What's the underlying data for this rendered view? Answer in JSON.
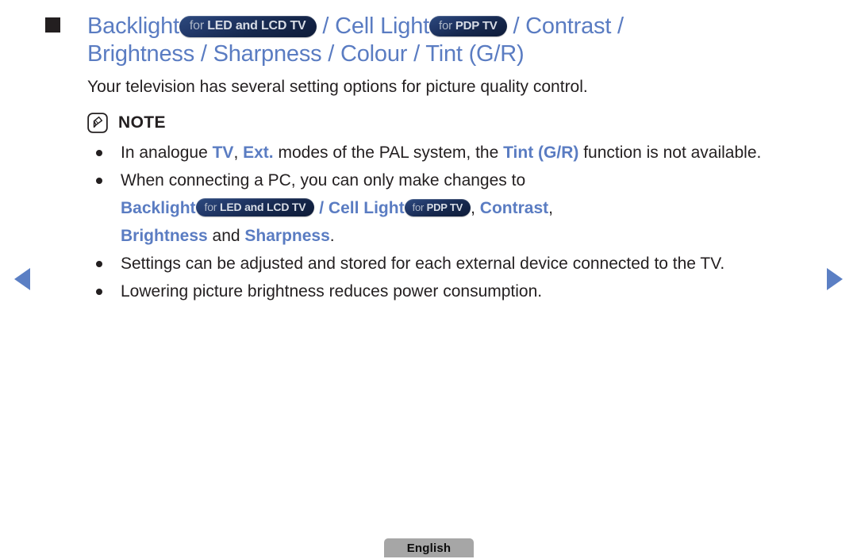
{
  "nav": {
    "prev_label": "Previous page",
    "next_label": "Next page"
  },
  "heading": {
    "part1": "Backlight",
    "badge1_lead": "for",
    "badge1_text": "LED and LCD TV",
    "sep1": " / ",
    "part2": "Cell Light",
    "badge2_lead": "for",
    "badge2_text": "PDP TV",
    "sep2": " / ",
    "part3": "Contrast /",
    "line2": "Brightness / Sharpness / Colour / Tint (G/R)"
  },
  "intro": "Your television has several setting options for picture quality control.",
  "note": {
    "icon": "note-pencil-icon",
    "label": "NOTE",
    "items": [
      {
        "seg1": "In analogue ",
        "blue1": "TV",
        "seg2": ", ",
        "blue2": "Ext.",
        "seg3": " modes of the PAL system, the ",
        "blue3": "Tint (G/R)",
        "seg4": " function is not available."
      },
      {
        "seg1": "When connecting a PC, you can only make changes to",
        "sub_backlight": "Backlight",
        "sub_badge1_lead": "for",
        "sub_badge1_text": "LED and LCD TV",
        "sub_sep1": " / ",
        "sub_cell": "Cell Light",
        "sub_badge2_lead": "for",
        "sub_badge2_text": "PDP TV",
        "sub_comma1": ", ",
        "sub_contrast": "Contrast",
        "sub_comma2": ",",
        "sub_brightness": "Brightness",
        "sub_and": " and ",
        "sub_sharpness": "Sharpness",
        "sub_period": "."
      },
      {
        "text": "Settings can be adjusted and stored for each external device connected to the TV."
      },
      {
        "text": "Lowering picture brightness reduces power consumption."
      }
    ]
  },
  "footer": {
    "language": "English"
  },
  "colors": {
    "accent_blue": "#5a7cc2",
    "badge_navy": "#16284d",
    "text_black": "#231f20",
    "chip_grey": "#a6a6a6"
  }
}
